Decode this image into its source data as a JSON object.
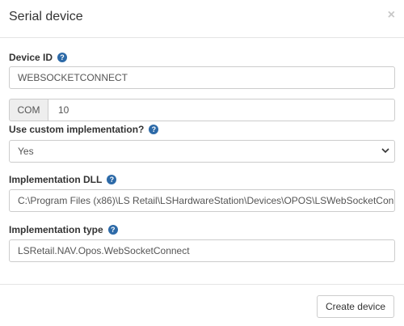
{
  "modal": {
    "title": "Serial device",
    "close_label": "×"
  },
  "fields": {
    "device_id": {
      "label": "Device ID",
      "value": "WEBSOCKETCONNECT"
    },
    "com": {
      "addon": "COM",
      "value": "10"
    },
    "custom_impl": {
      "label": "Use custom implementation?",
      "value": "Yes"
    },
    "impl_dll": {
      "label": "Implementation DLL",
      "value": "C:\\Program Files (x86)\\LS Retail\\LSHardwareStation\\Devices\\OPOS\\LSWebSocketCon"
    },
    "impl_type": {
      "label": "Implementation type",
      "value": "LSRetail.NAV.Opos.WebSocketConnect"
    }
  },
  "footer": {
    "create_label": "Create device"
  },
  "icons": {
    "help": "question-circle-icon",
    "close": "close-icon",
    "dropdown": "chevron-down-icon"
  },
  "colors": {
    "help_icon": "#2d6aa8",
    "border": "#cccccc",
    "addon_bg": "#eeeeee"
  }
}
